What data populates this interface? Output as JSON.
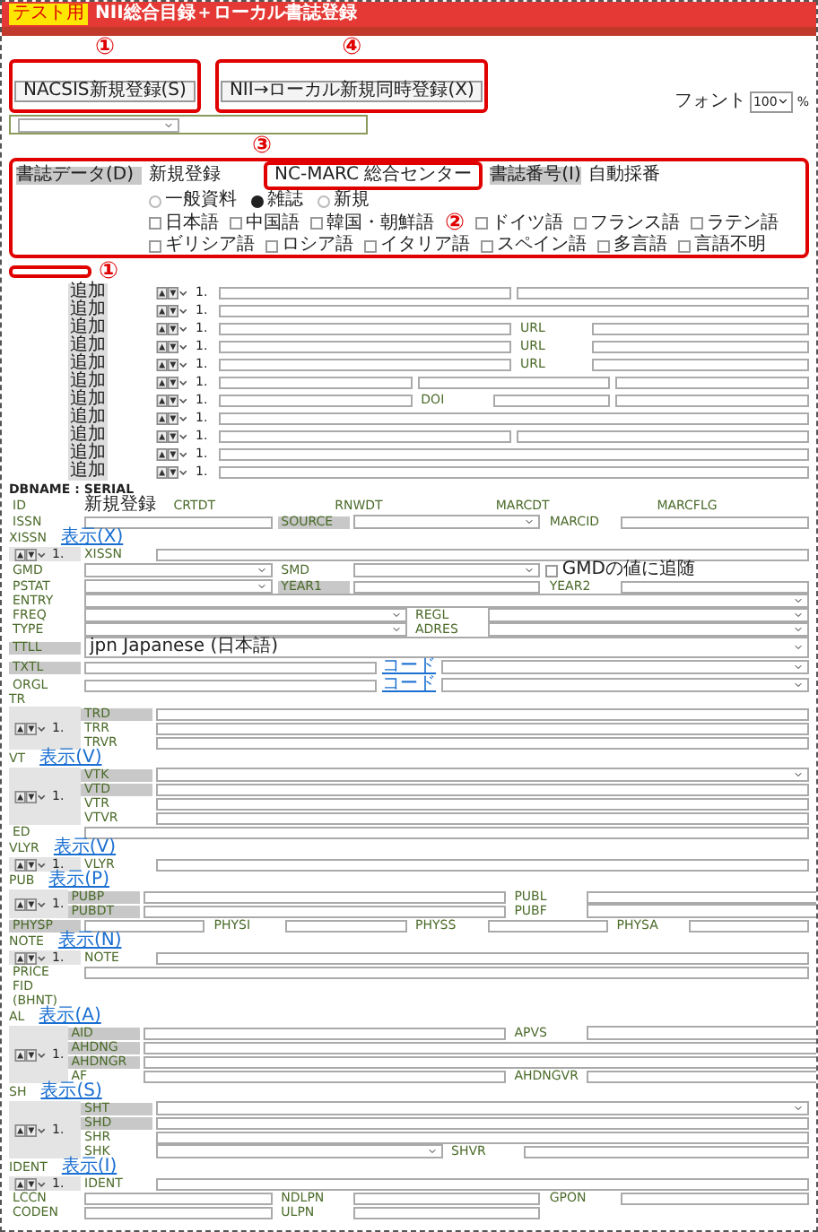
{
  "header": {
    "badge": "テスト用",
    "title": "NII総合目録＋ローカル書誌登録"
  },
  "register_buttons": [
    {
      "label": "NACSIS新規登録(S)",
      "mark": "①"
    },
    {
      "label": "NII→ローカル新規同時登録(X)",
      "mark": "④"
    }
  ],
  "font_size": {
    "label": "フォント",
    "value": "100",
    "unit": "%"
  },
  "record": {
    "label": "書誌データ(D)",
    "value": "新規登録",
    "source": "NC-MARC 総合センター",
    "source_mark": "③",
    "number_label": "書誌番号(I)",
    "number_value": "自動採番",
    "box_mark": "②"
  },
  "material_types": [
    {
      "label": "一般資料",
      "selected": false
    },
    {
      "label": "雑誌",
      "selected": true
    },
    {
      "label": "新規",
      "selected": false
    }
  ],
  "languages": [
    {
      "label": "日本語",
      "checked": false
    },
    {
      "label": "中国語",
      "checked": false
    },
    {
      "label": "韓国・朝鮮語",
      "checked": false
    },
    {
      "label": "ドイツ語",
      "checked": false
    },
    {
      "label": "フランス語",
      "checked": false
    },
    {
      "label": "ラテン語",
      "checked": false
    },
    {
      "label": "ギリシア語",
      "checked": false
    },
    {
      "label": "ロシア語",
      "checked": false
    },
    {
      "label": "イタリア語",
      "checked": false
    },
    {
      "label": "スペイン語",
      "checked": false
    },
    {
      "label": "多言語",
      "checked": false
    },
    {
      "label": "言語不明",
      "checked": false
    }
  ],
  "bottom_mark": "①",
  "link_rows": [
    {
      "add": "追加",
      "index": "1.",
      "fields": [
        {
          "kind": "input"
        },
        {
          "kind": "input"
        }
      ]
    },
    {
      "add": "追加",
      "index": "1.",
      "fields": [
        {
          "kind": "input"
        }
      ]
    },
    {
      "add": "追加",
      "index": "1.",
      "fields": [
        {
          "kind": "input"
        },
        {
          "label": "URL",
          "kind": "input"
        }
      ]
    },
    {
      "add": "追加",
      "index": "1.",
      "fields": [
        {
          "kind": "input"
        },
        {
          "label": "URL",
          "kind": "input"
        }
      ]
    },
    {
      "add": "追加",
      "index": "1.",
      "fields": [
        {
          "kind": "input"
        },
        {
          "label": "URL",
          "kind": "input"
        }
      ]
    },
    {
      "add": "追加",
      "index": "1.",
      "fields": [
        {
          "kind": "input"
        },
        {
          "kind": "input"
        },
        {
          "kind": "input"
        }
      ]
    },
    {
      "add": "追加",
      "index": "1.",
      "fields": [
        {
          "kind": "input"
        },
        {
          "label": "DOI",
          "kind": "input"
        },
        {
          "kind": "input"
        }
      ]
    },
    {
      "add": "追加",
      "index": "1.",
      "fields": [
        {
          "kind": "input"
        }
      ]
    },
    {
      "add": "追加",
      "index": "1.",
      "fields": [
        {
          "kind": "input"
        },
        {
          "kind": "input"
        }
      ]
    },
    {
      "add": "追加",
      "index": "1.",
      "fields": [
        {
          "kind": "input"
        }
      ]
    },
    {
      "add": "追加",
      "index": "1.",
      "fields": [
        {
          "kind": "input"
        }
      ]
    }
  ],
  "serial": {
    "title": "DBNAME : SERIAL",
    "items": [
      {
        "kind": "row",
        "fields": [
          {
            "label": "ID",
            "kind": "text",
            "value": "新規登録"
          },
          {
            "label": "CRTDT",
            "kind": "text"
          },
          {
            "label": "RNWDT",
            "kind": "text"
          },
          {
            "label": "MARCDT",
            "kind": "text"
          },
          {
            "label": "MARCFLG",
            "kind": "text"
          }
        ]
      },
      {
        "kind": "row",
        "fields": [
          {
            "label": "ISSN",
            "kind": "input"
          },
          {
            "label": "SOURCE",
            "kind": "select",
            "required": true
          },
          {
            "label": "MARCID",
            "kind": "input"
          }
        ]
      },
      {
        "kind": "group",
        "index": "1.",
        "code": "XISSN",
        "link": "表示(X)",
        "subs": [
          [
            {
              "label": "XISSN",
              "kind": "input"
            }
          ]
        ]
      },
      {
        "kind": "row",
        "fields": [
          {
            "label": "GMD",
            "kind": "select"
          },
          {
            "label": "SMD",
            "kind": "select"
          },
          {
            "label": "GMDの値に追随",
            "kind": "check",
            "checked": false
          }
        ]
      },
      {
        "kind": "row",
        "fields": [
          {
            "label": "PSTAT",
            "kind": "select"
          },
          {
            "label": "YEAR1",
            "kind": "input",
            "required": true
          },
          {
            "label": "YEAR2",
            "kind": "input"
          }
        ]
      },
      {
        "kind": "row",
        "fields": [
          {
            "label": "ENTRY",
            "kind": "select"
          }
        ]
      },
      {
        "kind": "row",
        "fields": [
          {
            "label": "FREQ",
            "kind": "select"
          },
          {
            "label": "REGL",
            "kind": "select"
          }
        ]
      },
      {
        "kind": "row",
        "fields": [
          {
            "label": "TYPE",
            "kind": "select"
          },
          {
            "label": "ADRES",
            "kind": "select"
          }
        ]
      },
      {
        "kind": "row",
        "fields": [
          {
            "label": "TTLL",
            "kind": "select",
            "required": true,
            "value": "jpn Japanese (日本語)"
          }
        ]
      },
      {
        "kind": "row",
        "fields": [
          {
            "label": "TXTL",
            "kind": "input",
            "required": true
          },
          {
            "label": "コード",
            "kind": "link"
          },
          {
            "kind": "select"
          }
        ]
      },
      {
        "kind": "row",
        "fields": [
          {
            "label": "ORGL",
            "kind": "input"
          },
          {
            "label": "コード",
            "kind": "link"
          },
          {
            "kind": "select"
          }
        ]
      },
      {
        "kind": "group",
        "index": "1.",
        "code": "TR",
        "subs": [
          [
            {
              "label": "TRD",
              "kind": "input",
              "required": true
            }
          ],
          [
            {
              "label": "TRR",
              "kind": "input"
            }
          ],
          [
            {
              "label": "TRVR",
              "kind": "input"
            }
          ]
        ]
      },
      {
        "kind": "group",
        "index": "1.",
        "code": "VT",
        "link": "表示(V)",
        "subs": [
          [
            {
              "label": "VTK",
              "kind": "select",
              "required": true
            }
          ],
          [
            {
              "label": "VTD",
              "kind": "input",
              "required": true
            }
          ],
          [
            {
              "label": "VTR",
              "kind": "input"
            }
          ],
          [
            {
              "label": "VTVR",
              "kind": "input"
            }
          ]
        ]
      },
      {
        "kind": "row",
        "fields": [
          {
            "label": "ED",
            "kind": "input"
          }
        ]
      },
      {
        "kind": "group",
        "index": "1.",
        "code": "VLYR",
        "link": "表示(V)",
        "subs": [
          [
            {
              "label": "VLYR",
              "kind": "input"
            }
          ]
        ]
      },
      {
        "kind": "group",
        "index": "1.",
        "code": "PUB",
        "link": "表示(P)",
        "subs": [
          [
            {
              "label": "PUBP",
              "kind": "input",
              "required": true
            },
            {
              "label": "PUBL",
              "kind": "input"
            }
          ],
          [
            {
              "label": "PUBDT",
              "kind": "input",
              "required": true
            },
            {
              "label": "PUBF",
              "kind": "select"
            }
          ]
        ]
      },
      {
        "kind": "row",
        "fields": [
          {
            "label": "PHYSP",
            "kind": "input",
            "required": true
          },
          {
            "label": "PHYSI",
            "kind": "input"
          },
          {
            "label": "PHYSS",
            "kind": "input"
          },
          {
            "label": "PHYSA",
            "kind": "input"
          }
        ]
      },
      {
        "kind": "group",
        "index": "1.",
        "code": "NOTE",
        "link": "表示(N)",
        "subs": [
          [
            {
              "label": "NOTE",
              "kind": "input"
            }
          ]
        ]
      },
      {
        "kind": "row",
        "fields": [
          {
            "label": "PRICE",
            "kind": "input"
          }
        ]
      },
      {
        "kind": "row",
        "fields": [
          {
            "label": "FID",
            "kind": "text"
          }
        ]
      },
      {
        "kind": "row",
        "fields": [
          {
            "label": "(BHNT)",
            "kind": "text"
          }
        ]
      },
      {
        "kind": "group",
        "index": "1.",
        "code": "AL",
        "link": "表示(A)",
        "subs": [
          [
            {
              "label": "AID",
              "kind": "input",
              "required": true
            },
            {
              "label": "APVS",
              "kind": "select"
            }
          ],
          [
            {
              "label": "AHDNG",
              "kind": "input",
              "required": true
            }
          ],
          [
            {
              "label": "AHDNGR",
              "kind": "input",
              "required": true
            }
          ],
          [
            {
              "label": "AF",
              "kind": "input"
            },
            {
              "label": "AHDNGVR",
              "kind": "input"
            }
          ]
        ]
      },
      {
        "kind": "group",
        "index": "1.",
        "code": "SH",
        "link": "表示(S)",
        "subs": [
          [
            {
              "label": "SHT",
              "kind": "select",
              "required": true
            }
          ],
          [
            {
              "label": "SHD",
              "kind": "input",
              "required": true
            }
          ],
          [
            {
              "label": "SHR",
              "kind": "input"
            }
          ],
          [
            {
              "label": "SHK",
              "kind": "select"
            },
            {
              "label": "SHVR",
              "kind": "input"
            }
          ]
        ]
      },
      {
        "kind": "group",
        "index": "1.",
        "code": "IDENT",
        "link": "表示(I)",
        "subs": [
          [
            {
              "label": "IDENT",
              "kind": "input"
            }
          ]
        ]
      },
      {
        "kind": "row",
        "fields": [
          {
            "label": "LCCN",
            "kind": "input"
          },
          {
            "label": "NDLPN",
            "kind": "input"
          },
          {
            "label": "GPON",
            "kind": "input"
          }
        ]
      },
      {
        "kind": "row",
        "fields": [
          {
            "label": "CODEN",
            "kind": "input"
          },
          {
            "label": "ULPN",
            "kind": "input"
          },
          {
            "kind": "blank"
          }
        ]
      }
    ]
  }
}
